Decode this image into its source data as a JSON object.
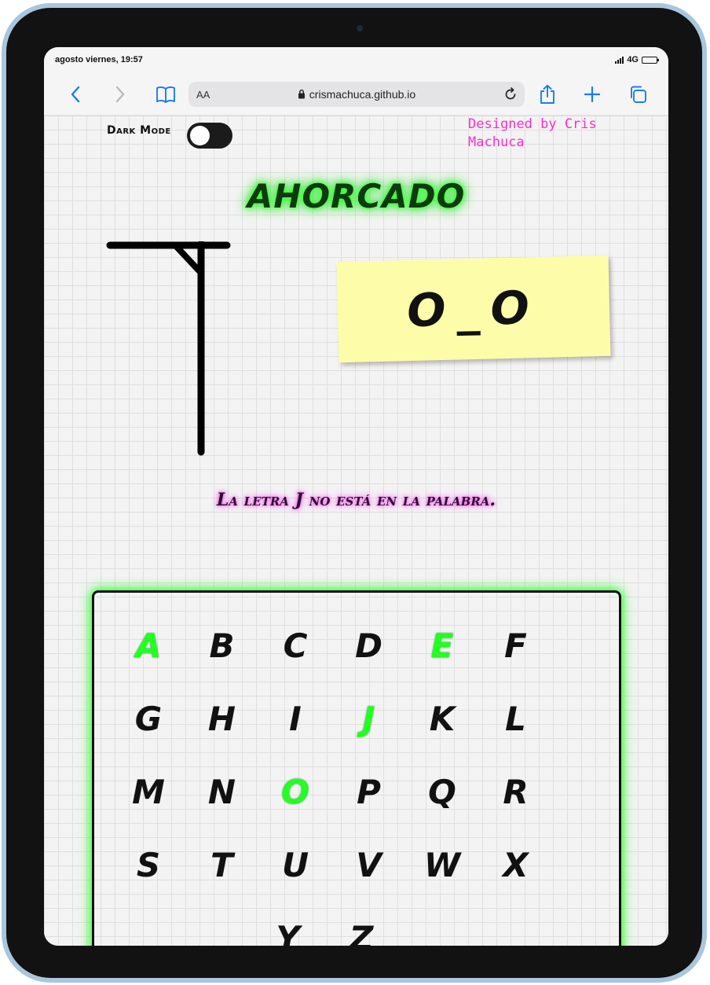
{
  "status_bar": {
    "time": "agosto viernes, 19:57",
    "network": "4G"
  },
  "browser": {
    "text_size_label": "AA",
    "url": "crismachuca.github.io"
  },
  "page": {
    "dark_mode_label": "Dark Mode",
    "dark_mode_on": false,
    "credit": "Designed by Cris Machuca",
    "title": "AHORCADO",
    "word_display": "O_O",
    "message": "La letra J no está en la palabra.",
    "keys": [
      {
        "letter": "A",
        "used": true
      },
      {
        "letter": "B",
        "used": false
      },
      {
        "letter": "C",
        "used": false
      },
      {
        "letter": "D",
        "used": false
      },
      {
        "letter": "E",
        "used": true
      },
      {
        "letter": "F",
        "used": false
      },
      {
        "letter": "G",
        "used": false
      },
      {
        "letter": "H",
        "used": false
      },
      {
        "letter": "I",
        "used": false
      },
      {
        "letter": "J",
        "used": true
      },
      {
        "letter": "K",
        "used": false
      },
      {
        "letter": "L",
        "used": false
      },
      {
        "letter": "M",
        "used": false
      },
      {
        "letter": "N",
        "used": false
      },
      {
        "letter": "O",
        "used": true
      },
      {
        "letter": "P",
        "used": false
      },
      {
        "letter": "Q",
        "used": false
      },
      {
        "letter": "R",
        "used": false
      },
      {
        "letter": "S",
        "used": false
      },
      {
        "letter": "T",
        "used": false
      },
      {
        "letter": "U",
        "used": false
      },
      {
        "letter": "V",
        "used": false
      },
      {
        "letter": "W",
        "used": false
      },
      {
        "letter": "X",
        "used": false
      },
      {
        "letter": "Y",
        "used": false
      },
      {
        "letter": "Z",
        "used": false
      }
    ]
  },
  "colors": {
    "title_glow": "#35ff35",
    "credit": "#ff2bd0",
    "message_glow": "#ff4df0",
    "sticky_note": "#fdfda9",
    "used_key": "#22ff22"
  }
}
